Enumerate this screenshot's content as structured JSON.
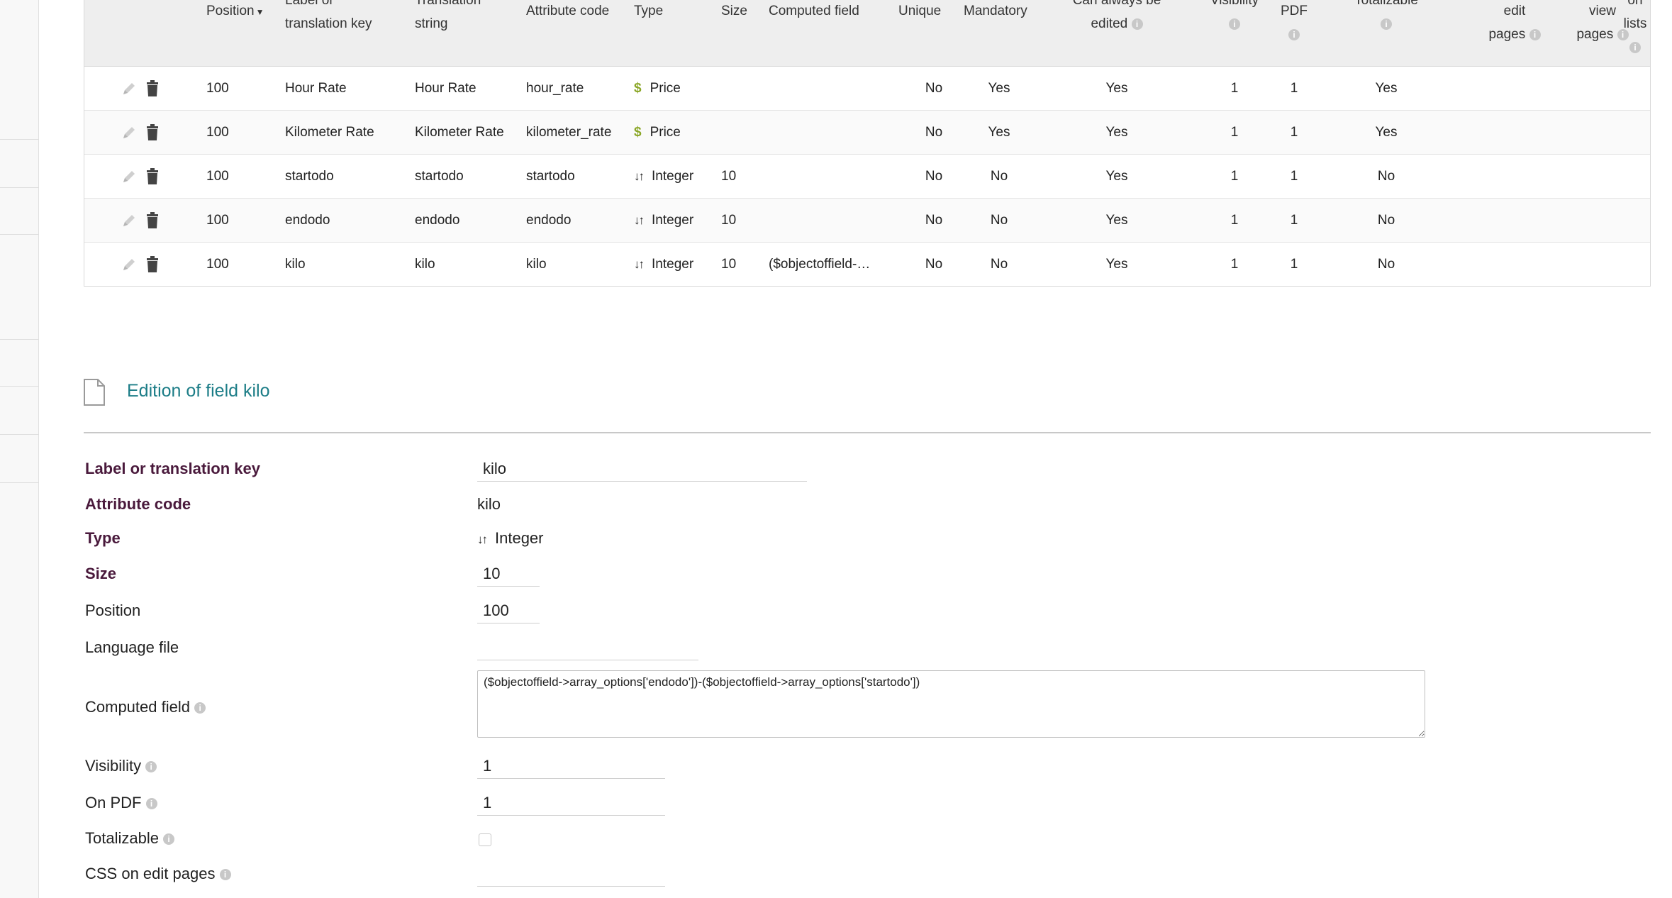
{
  "table": {
    "headers": {
      "position": "Position",
      "label": [
        "Label or",
        "translation key"
      ],
      "translation": [
        "Translation",
        "string"
      ],
      "attribute_code": "Attribute code",
      "type": "Type",
      "size": "Size",
      "computed_field": "Computed field",
      "unique": "Unique",
      "mandatory": "Mandatory",
      "can_edit": [
        "Can always be",
        "edited"
      ],
      "visibility": "Visibility",
      "pdf": "PDF",
      "totalizable": "Totalizable",
      "css_edit": [
        "edit",
        "pages"
      ],
      "css_view": [
        "view",
        "pages"
      ],
      "css_lists": [
        "on",
        "lists"
      ]
    },
    "rows": [
      {
        "position": "100",
        "label": "Hour Rate",
        "translation": "Hour Rate",
        "code": "hour_rate",
        "type": "Price",
        "type_icon": "dollar-icon",
        "size": "",
        "computed": "",
        "unique": "No",
        "mandatory": "Yes",
        "can_edit": "Yes",
        "visibility": "1",
        "pdf": "1",
        "totalizable": "Yes"
      },
      {
        "position": "100",
        "label": "Kilometer Rate",
        "translation": "Kilometer Rate",
        "code": "kilometer_rate",
        "type": "Price",
        "type_icon": "dollar-icon",
        "size": "",
        "computed": "",
        "unique": "No",
        "mandatory": "Yes",
        "can_edit": "Yes",
        "visibility": "1",
        "pdf": "1",
        "totalizable": "Yes"
      },
      {
        "position": "100",
        "label": "startodo",
        "translation": "startodo",
        "code": "startodo",
        "type": "Integer",
        "type_icon": "sort-numeric-icon",
        "size": "10",
        "computed": "",
        "unique": "No",
        "mandatory": "No",
        "can_edit": "Yes",
        "visibility": "1",
        "pdf": "1",
        "totalizable": "No"
      },
      {
        "position": "100",
        "label": "endodo",
        "translation": "endodo",
        "code": "endodo",
        "type": "Integer",
        "type_icon": "sort-numeric-icon",
        "size": "10",
        "computed": "",
        "unique": "No",
        "mandatory": "No",
        "can_edit": "Yes",
        "visibility": "1",
        "pdf": "1",
        "totalizable": "No"
      },
      {
        "position": "100",
        "label": "kilo",
        "translation": "kilo",
        "code": "kilo",
        "type": "Integer",
        "type_icon": "sort-numeric-icon",
        "size": "10",
        "computed": "($objectoffield-…",
        "unique": "No",
        "mandatory": "No",
        "can_edit": "Yes",
        "visibility": "1",
        "pdf": "1",
        "totalizable": "No"
      }
    ]
  },
  "section": {
    "title": "Edition of field kilo"
  },
  "form": {
    "label_key": {
      "label": "Label or translation key",
      "value": "kilo"
    },
    "attribute_code": {
      "label": "Attribute code",
      "value": "kilo"
    },
    "type": {
      "label": "Type",
      "value": "Integer"
    },
    "size": {
      "label": "Size",
      "value": "10"
    },
    "position": {
      "label": "Position",
      "value": "100"
    },
    "language_file": {
      "label": "Language file",
      "value": ""
    },
    "computed_field": {
      "label": "Computed field",
      "value": "($objectoffield->array_options['endodo'])-($objectoffield->array_options['startodo'])"
    },
    "visibility": {
      "label": "Visibility",
      "value": "1"
    },
    "on_pdf": {
      "label": "On PDF",
      "value": "1"
    },
    "totalizable": {
      "label": "Totalizable",
      "checked": false
    },
    "css_edit": {
      "label": "CSS on edit pages",
      "value": ""
    }
  },
  "colors": {
    "title_teal": "#1c7d87",
    "label_maroon": "#4a1a3c",
    "price_green": "#8aa626"
  }
}
